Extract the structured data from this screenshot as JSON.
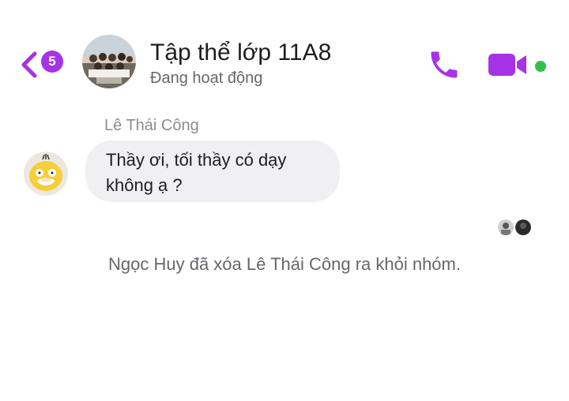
{
  "header": {
    "unread_count": "5",
    "title": "Tập thể lớp 11A8",
    "status": "Đang hoạt động",
    "icons": {
      "back": "chevron-left-icon",
      "call": "phone-icon",
      "video": "video-camera-icon",
      "online": "online-dot"
    }
  },
  "conversation": {
    "sender_name": "Lê Thái Công",
    "message_lines": [
      "Thầy ơi, tối thầy có dạy",
      "không ạ ?"
    ],
    "system_notice": "Ngọc Huy đã xóa Lê Thái Công ra khỏi nhóm."
  },
  "colors": {
    "accent": "#a633e6",
    "online": "#31c24d",
    "bubble": "#f0f0f2",
    "muted_text": "#65676b"
  }
}
